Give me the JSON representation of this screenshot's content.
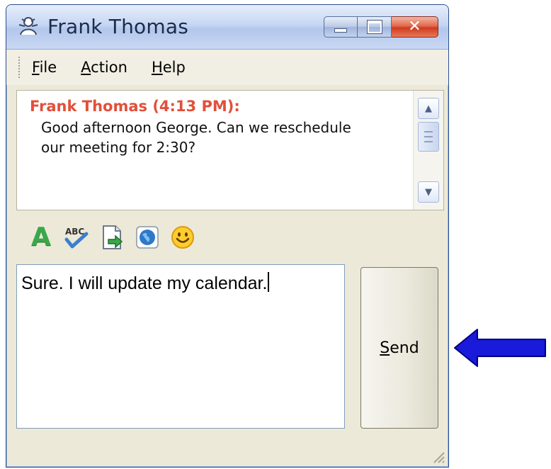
{
  "window": {
    "title": "Frank Thomas"
  },
  "menu": {
    "file_accel": "F",
    "file_rest": "ile",
    "action_accel": "A",
    "action_rest": "ction",
    "help_accel": "H",
    "help_rest": "elp"
  },
  "chat": {
    "sender_line": "Frank Thomas (4:13 PM):",
    "message_line1": "Good afternoon George. Can we reschedule",
    "message_line2": "our meeting for 2:30?"
  },
  "toolbar": {
    "font_glyph": "A",
    "icons": [
      "font-color-icon",
      "spell-check-icon",
      "send-file-icon",
      "globe-icon",
      "smiley-icon"
    ]
  },
  "compose": {
    "value": "Sure. I will update my calendar."
  },
  "send": {
    "accel": "S",
    "rest": "end"
  },
  "colors": {
    "sender": "#e1503a",
    "window_bg": "#ece9d8",
    "arrow": "#1a1adb"
  }
}
